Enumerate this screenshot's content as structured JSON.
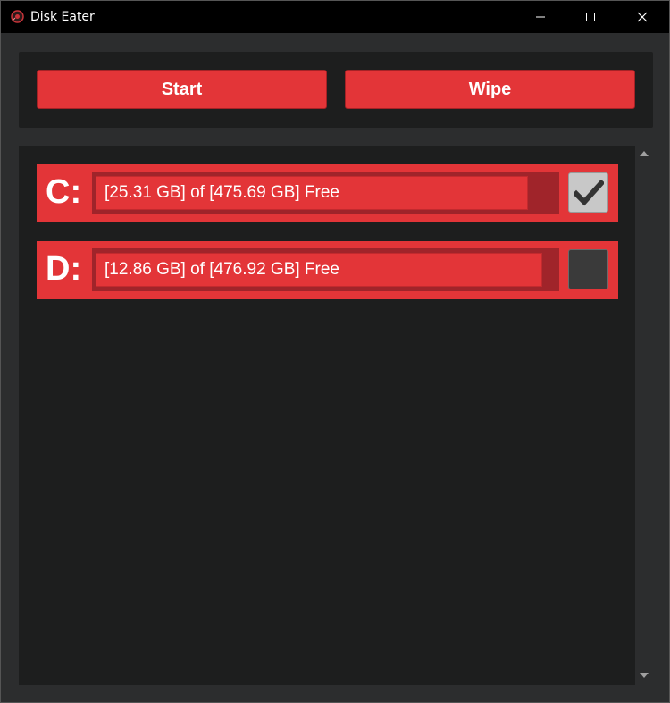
{
  "window": {
    "title": "Disk Eater",
    "icon": "disk-eater-app-icon",
    "controls": [
      "minimize-icon",
      "maximize-icon",
      "close-icon"
    ]
  },
  "toolbar": {
    "start_label": "Start",
    "wipe_label": "Wipe"
  },
  "drives": [
    {
      "letter": "C:",
      "free_text": "[25.31 GB] of [475.69 GB] Free",
      "free_gb": 25.31,
      "total_gb": 475.69,
      "bar_level": 0.94,
      "checked": true
    },
    {
      "letter": "D:",
      "free_text": "[12.86 GB] of [476.92 GB] Free",
      "free_gb": 12.86,
      "total_gb": 476.92,
      "bar_level": 0.97,
      "checked": false
    }
  ],
  "colors": {
    "accent": "#e33538",
    "bar_track": "#a0242a",
    "panel_bg": "#1d1e1e",
    "window_bg": "#2c2d2e",
    "titlebar_bg": "#000000"
  }
}
